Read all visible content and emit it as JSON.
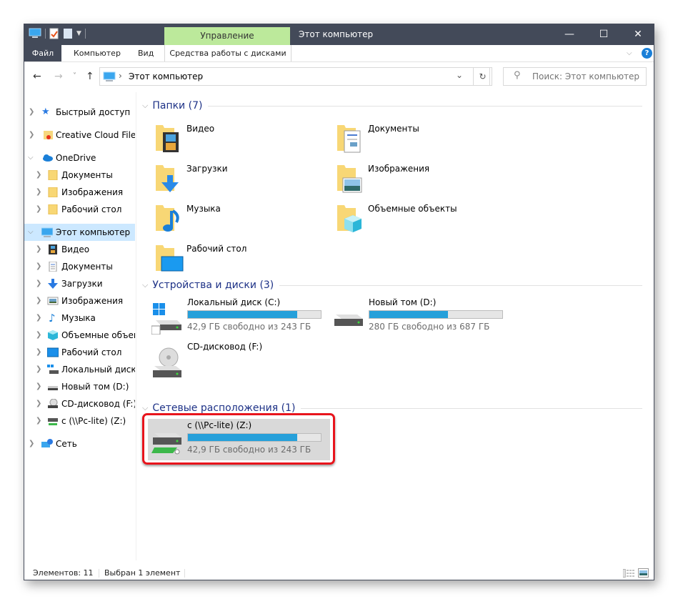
{
  "window": {
    "title": "Этот компьютер",
    "context_tab": "Управление",
    "controls": {
      "minimize": "—",
      "maximize": "☐",
      "close": "✕"
    }
  },
  "ribbon": {
    "tabs": [
      "Файл",
      "Компьютер",
      "Вид",
      "Средства работы с дисками"
    ],
    "collapse_icon": "chevron-down-icon",
    "help_icon": "?"
  },
  "nav": {
    "back": "←",
    "forward": "→",
    "recent": "˅",
    "up": "↑",
    "breadcrumb": [
      "Этот компьютер"
    ],
    "breadcrumb_sep": "›",
    "dropdown": "⌄",
    "refresh": "↻",
    "search_placeholder": "Поиск: Этот компьютер"
  },
  "sidebar": {
    "items": [
      {
        "label": "Быстрый доступ",
        "icon": "star-icon",
        "expanded": false
      },
      {
        "label": "Creative Cloud Files",
        "icon": "creative-cloud-folder-icon",
        "expanded": false
      },
      {
        "label": "OneDrive",
        "icon": "cloud-icon",
        "expanded": true
      },
      {
        "label": "Документы",
        "icon": "folder-icon",
        "expanded": false
      },
      {
        "label": "Изображения",
        "icon": "folder-icon",
        "expanded": false
      },
      {
        "label": "Рабочий стол",
        "icon": "folder-icon",
        "expanded": false
      },
      {
        "label": "Этот компьютер",
        "icon": "computer-icon",
        "expanded": true,
        "selected": true
      },
      {
        "label": "Видео",
        "icon": "video-icon",
        "expanded": false
      },
      {
        "label": "Документы",
        "icon": "document-icon",
        "expanded": false
      },
      {
        "label": "Загрузки",
        "icon": "download-icon",
        "expanded": false
      },
      {
        "label": "Изображения",
        "icon": "picture-icon",
        "expanded": false
      },
      {
        "label": "Музыка",
        "icon": "music-icon",
        "expanded": false
      },
      {
        "label": "Объемные объект",
        "icon": "3d-objects-icon",
        "expanded": false
      },
      {
        "label": "Рабочий стол",
        "icon": "desktop-icon",
        "expanded": false
      },
      {
        "label": "Локальный диск (C",
        "icon": "system-drive-icon",
        "expanded": false
      },
      {
        "label": "Новый том (D:)",
        "icon": "drive-icon",
        "expanded": false
      },
      {
        "label": "CD-дисковод (F:)",
        "icon": "cd-drive-icon",
        "expanded": false
      },
      {
        "label": "c (\\\\Pc-lite) (Z:)",
        "icon": "network-drive-icon",
        "expanded": false
      },
      {
        "label": "Сеть",
        "icon": "network-icon",
        "expanded": false
      }
    ]
  },
  "groups": {
    "folders": {
      "title": "Папки (7)",
      "items": [
        {
          "name": "Видео",
          "icon": "video-folder-icon"
        },
        {
          "name": "Документы",
          "icon": "documents-folder-icon"
        },
        {
          "name": "Загрузки",
          "icon": "downloads-folder-icon"
        },
        {
          "name": "Изображения",
          "icon": "pictures-folder-icon"
        },
        {
          "name": "Музыка",
          "icon": "music-folder-icon"
        },
        {
          "name": "Объемные объекты",
          "icon": "3d-objects-folder-icon"
        },
        {
          "name": "Рабочий стол",
          "icon": "desktop-folder-icon"
        }
      ]
    },
    "devices": {
      "title": "Устройства и диски (3)",
      "items": [
        {
          "name": "Локальный диск (C:)",
          "free": "42,9 ГБ свободно из 243 ГБ",
          "used_fraction": 0.823,
          "icon": "system-drive-icon"
        },
        {
          "name": "Новый том (D:)",
          "free": "280 ГБ свободно из 687 ГБ",
          "used_fraction": 0.592,
          "icon": "drive-icon"
        },
        {
          "name": "CD-дисковод (F:)",
          "icon": "cd-drive-icon"
        }
      ]
    },
    "network": {
      "title": "Сетевые расположения (1)",
      "items": [
        {
          "name": "c (\\\\Pc-lite) (Z:)",
          "free": "42,9 ГБ свободно из 243 ГБ",
          "used_fraction": 0.823,
          "icon": "network-drive-icon",
          "selected": true,
          "highlighted": true
        }
      ]
    }
  },
  "status": {
    "count": "Элементов: 11",
    "selection": "Выбран 1 элемент"
  },
  "colors": {
    "titlebar": "#434a59",
    "context_tab": "#bce99b",
    "group_header": "#1e3287",
    "progress": "#26a0da",
    "selection": "#cce8ff",
    "highlight": "#e8141c"
  }
}
